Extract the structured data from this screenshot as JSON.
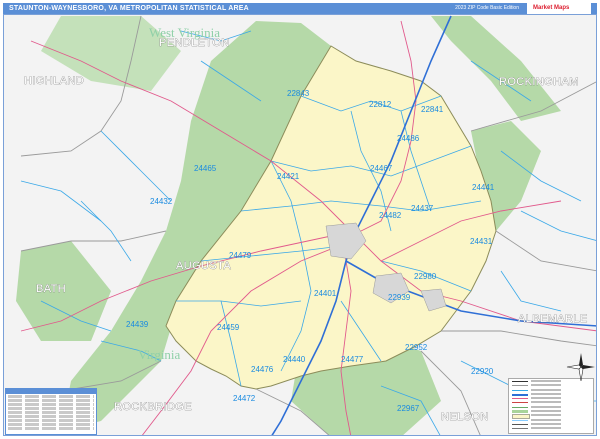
{
  "title": "STAUNTON-WAYNESBORO, VA METROPOLITAN STATISTICAL AREA",
  "edition": "2023 ZIP Code Basic Edition",
  "logo": "Market Maps",
  "counties": {
    "pendleton": "PENDLETON",
    "highland": "HIGHLAND",
    "rockingham": "ROCKINGHAM",
    "augusta": "AUGUSTA",
    "bath": "BATH",
    "albemarle": "ALBEMARLE",
    "rockbridge": "ROCKBRIDGE",
    "nelson": "NELSON"
  },
  "states": {
    "west_virginia": "West Virginia",
    "virginia": "Virginia"
  },
  "zips": {
    "z22843": "22843",
    "z22812": "22812",
    "z22841": "22841",
    "z24486": "24486",
    "z24465": "24465",
    "z24421": "24421",
    "z24467": "24467",
    "z24441": "24441",
    "z24432": "24432",
    "z24482": "24482",
    "z24437": "24437",
    "z24431": "24431",
    "z24479": "24479",
    "z22980": "22980",
    "z24401": "24401",
    "z22939": "22939",
    "z24439": "24439",
    "z24459": "24459",
    "z22952": "22952",
    "z24440": "24440",
    "z24477": "24477",
    "z24476": "24476",
    "z22920": "22920",
    "z24472": "24472",
    "z22967": "22967"
  },
  "colors": {
    "metro_fill": "#fbf6c8",
    "forest": "#a9d49a",
    "background": "#f2f2f2",
    "zip_line": "#3aa8e8",
    "interstate": "#2f6fd6",
    "highway": "#e15a8c",
    "title_bar": "#5b8fd6"
  },
  "icons": {
    "compass": "compass-rose-icon",
    "logo": "market-maps-logo"
  }
}
